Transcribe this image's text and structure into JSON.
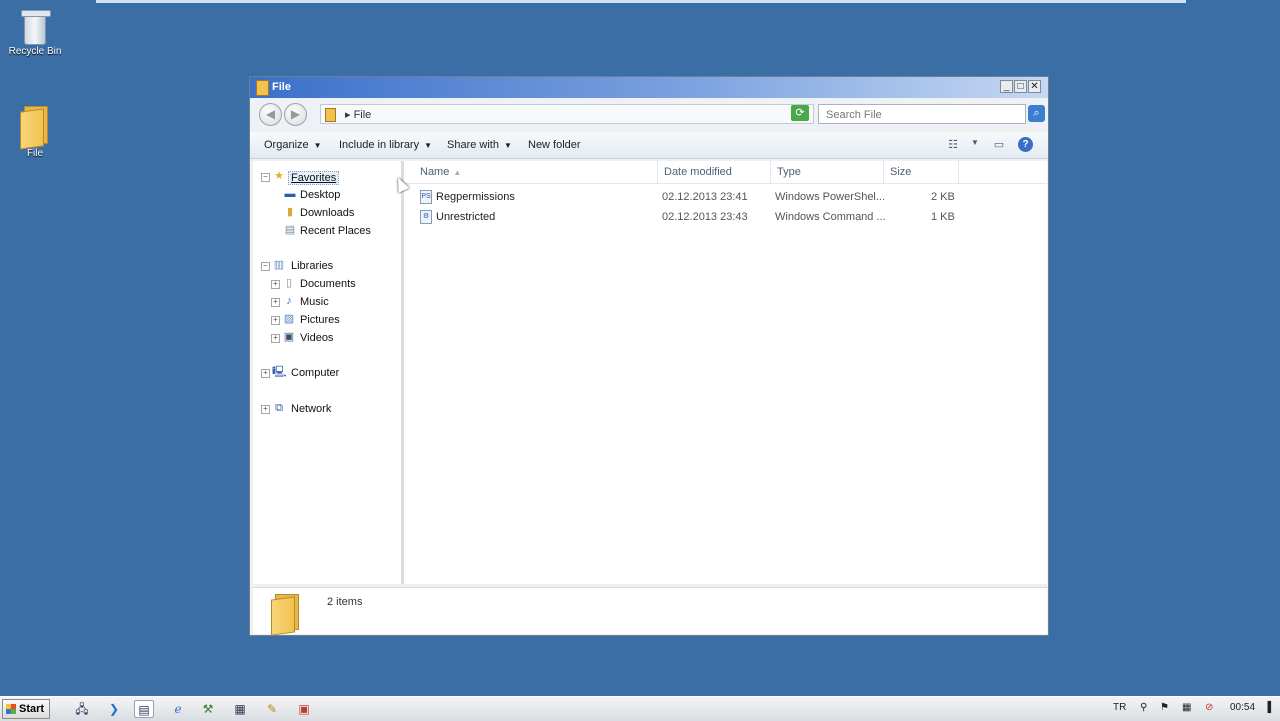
{
  "desktop": {
    "icons": [
      {
        "label": "Recycle Bin",
        "icon": "recycle-bin-icon"
      },
      {
        "label": "File",
        "icon": "folder-icon"
      }
    ]
  },
  "window": {
    "title": "File",
    "controls": {
      "minimize": "_",
      "maximize": "□",
      "close": "✕"
    },
    "address": {
      "path": "▸ File"
    },
    "search": {
      "placeholder": "Search File"
    },
    "toolbar": {
      "organize": "Organize",
      "include": "Include in library",
      "share": "Share with",
      "new_folder": "New folder"
    },
    "nav": {
      "favorites": "Favorites",
      "desktop": "Desktop",
      "downloads": "Downloads",
      "recent": "Recent Places",
      "libraries": "Libraries",
      "documents": "Documents",
      "music": "Music",
      "pictures": "Pictures",
      "videos": "Videos",
      "computer": "Computer",
      "network": "Network"
    },
    "columns": {
      "name": "Name",
      "date": "Date modified",
      "type": "Type",
      "size": "Size"
    },
    "files": [
      {
        "name": "Regpermissions",
        "date": "02.12.2013 23:41",
        "type": "Windows PowerShel...",
        "size": "2 KB",
        "icon": "powershell-script-icon"
      },
      {
        "name": "Unrestricted",
        "date": "02.12.2013 23:43",
        "type": "Windows Command ...",
        "size": "1 KB",
        "icon": "command-script-icon"
      }
    ],
    "details": {
      "count": "2 items"
    }
  },
  "taskbar": {
    "start": "Start",
    "lang": "TR",
    "clock": "00:54"
  }
}
